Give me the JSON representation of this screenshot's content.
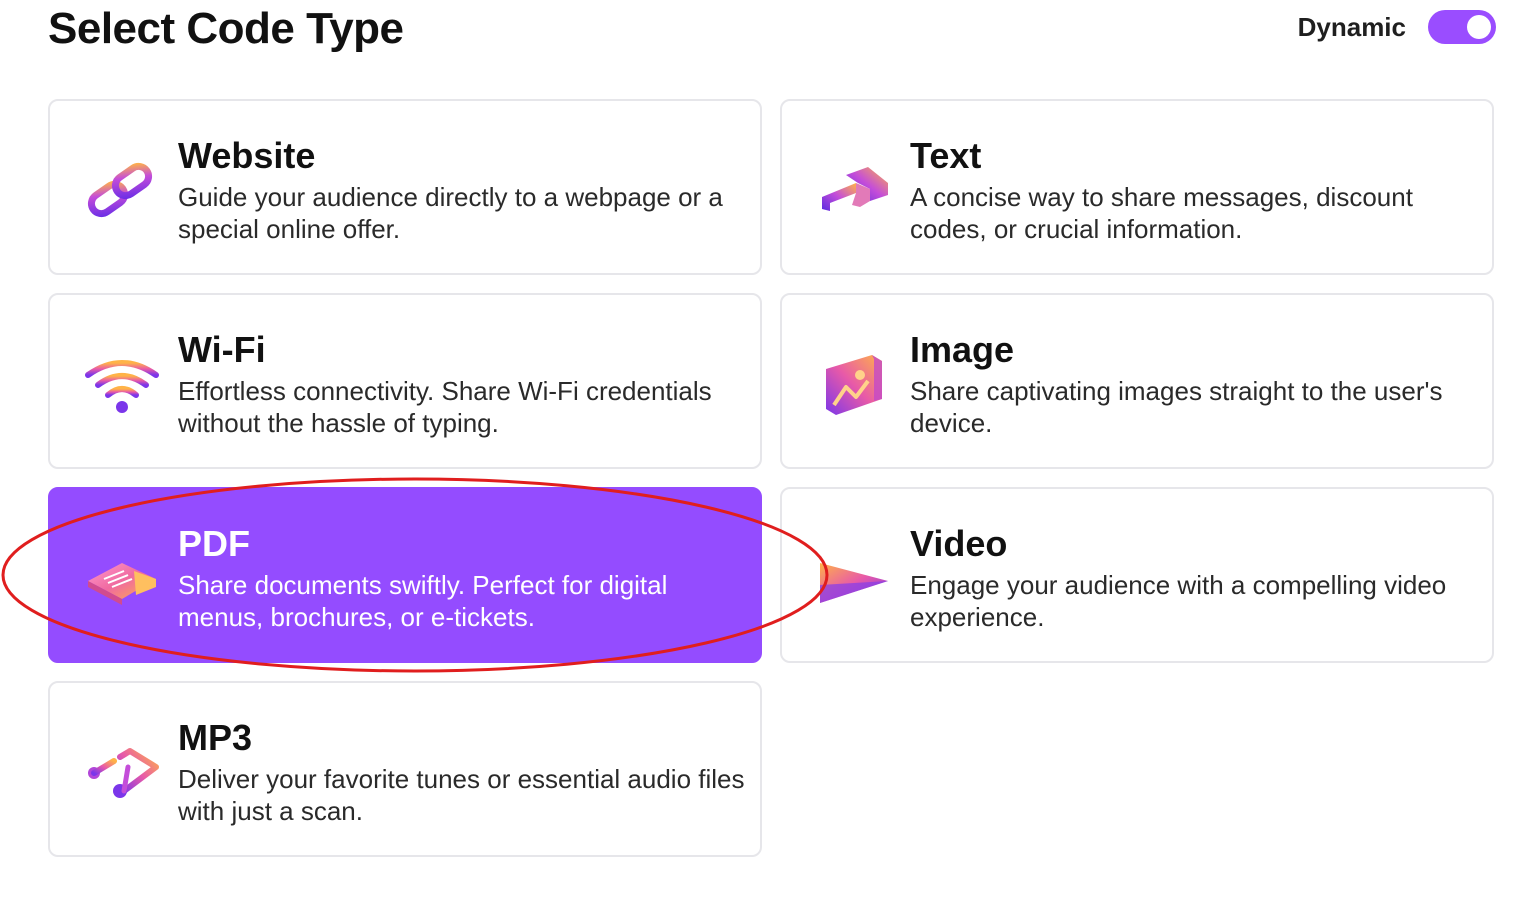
{
  "header": {
    "title": "Select Code Type",
    "dynamic_label": "Dynamic",
    "dynamic_on": true
  },
  "colors": {
    "accent": "#944cff",
    "toggle": "#9a4dff",
    "annotation": "#e01e1e"
  },
  "cards": [
    {
      "id": "website",
      "title": "Website",
      "description": "Guide your audience directly to a webpage or a special online offer.",
      "icon": "link-icon",
      "selected": false
    },
    {
      "id": "text",
      "title": "Text",
      "description": "A concise way to share messages, discount codes, or crucial information.",
      "icon": "text-icon",
      "selected": false
    },
    {
      "id": "wifi",
      "title": "Wi-Fi",
      "description": "Effortless connectivity. Share Wi-Fi credentials without the hassle of typing.",
      "icon": "wifi-icon",
      "selected": false
    },
    {
      "id": "image",
      "title": "Image",
      "description": "Share captivating images straight to the user's device.",
      "icon": "image-icon",
      "selected": false
    },
    {
      "id": "pdf",
      "title": "PDF",
      "description": "Share documents swiftly. Perfect for digital menus, brochures, or e-tickets.",
      "icon": "document-icon",
      "selected": true
    },
    {
      "id": "video",
      "title": "Video",
      "description": "Engage your audience with a compelling video experience.",
      "icon": "play-icon",
      "selected": false
    },
    {
      "id": "mp3",
      "title": "MP3",
      "description": "Deliver your favorite tunes or essential audio files with just a scan.",
      "icon": "music-note-icon",
      "selected": false
    }
  ]
}
